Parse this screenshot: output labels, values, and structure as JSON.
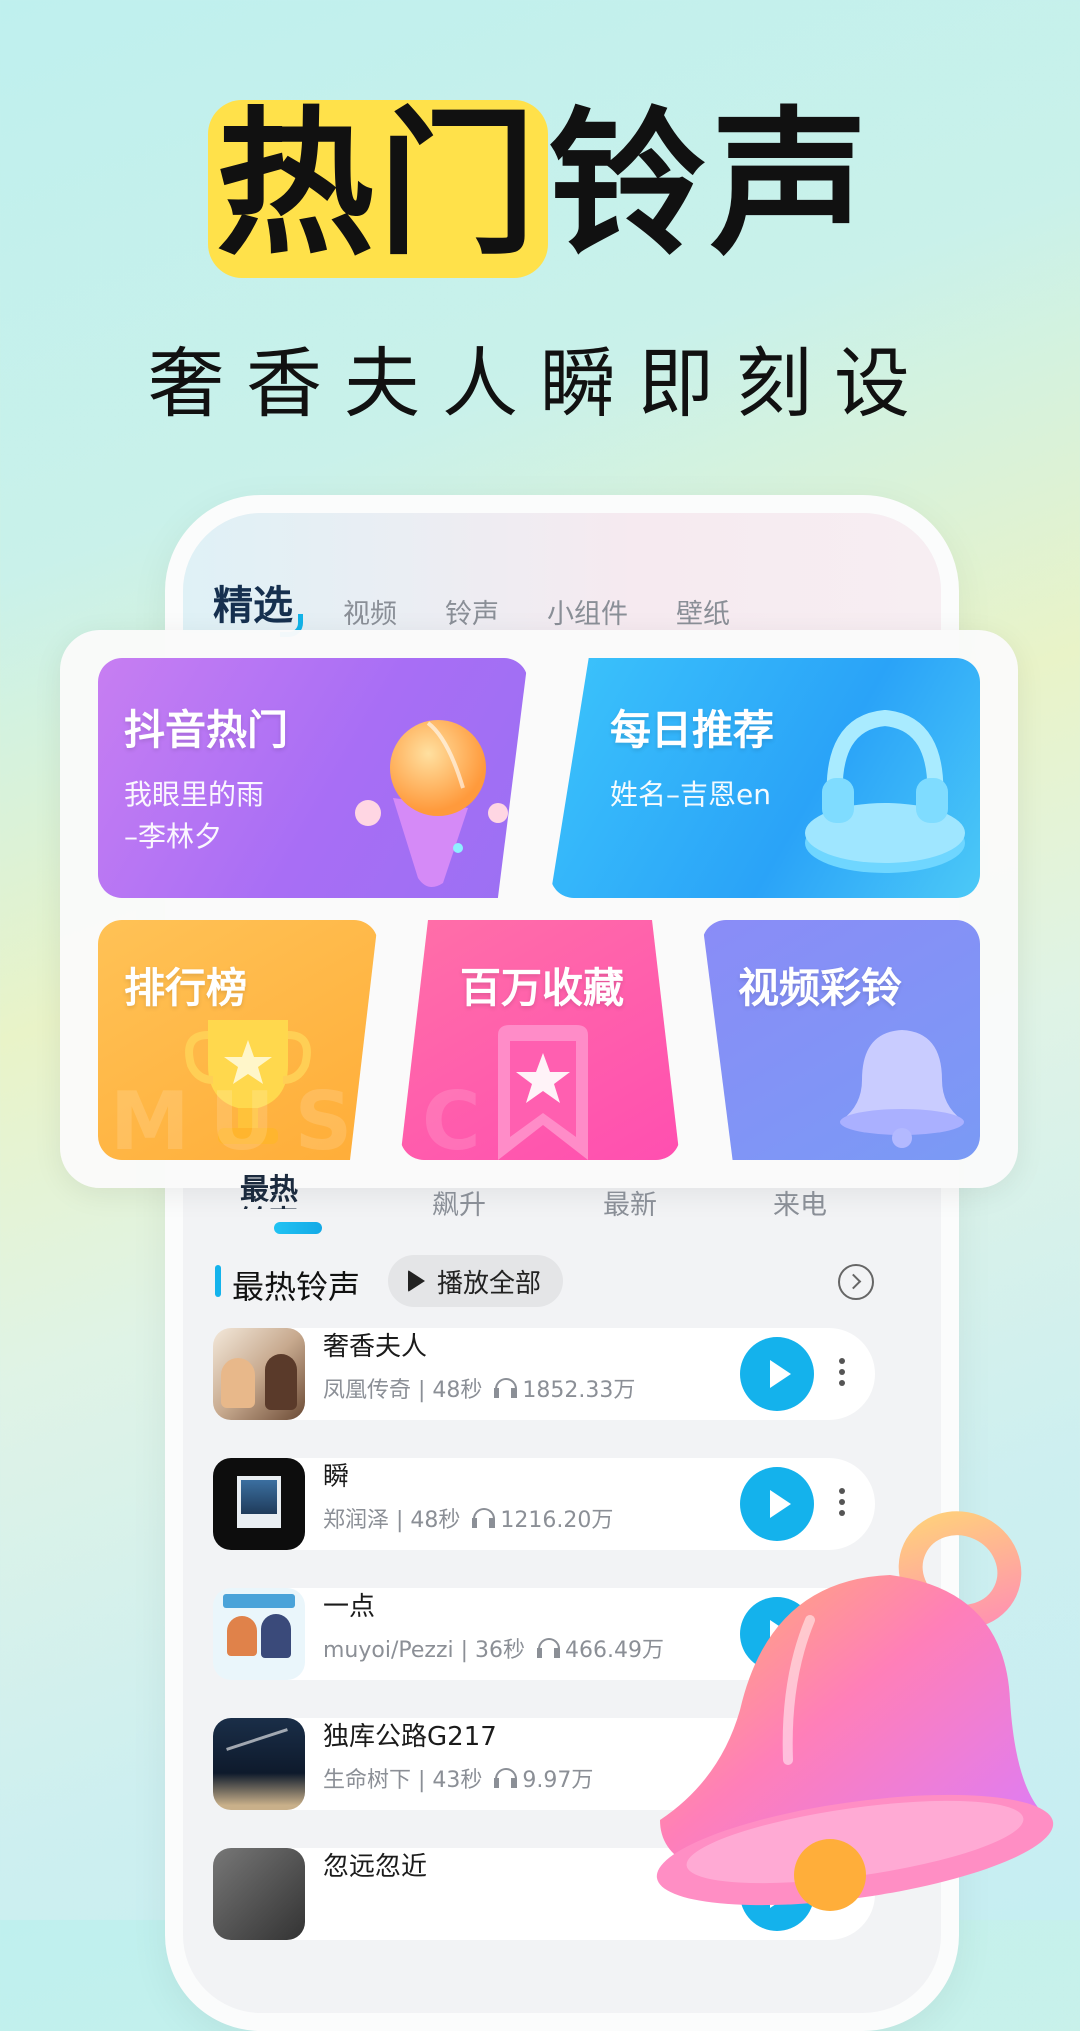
{
  "hero": {
    "title_highlight": "热门",
    "title_rest": "铃声",
    "subtitle": "奢香夫人瞬即刻设"
  },
  "tabs": [
    "精选",
    "视频",
    "铃声",
    "小组件",
    "壁纸"
  ],
  "features": {
    "douyin": {
      "title": "抖音热门",
      "sub1": "我眼里的雨",
      "sub2": "–李林夕"
    },
    "daily": {
      "title": "每日推荐",
      "sub": "姓名–吉恩en"
    },
    "rank": {
      "title": "排行榜"
    },
    "collect": {
      "title": "百万收藏"
    },
    "video": {
      "title": "视频彩铃"
    },
    "watermark": "MUSIC"
  },
  "rank_tabs": [
    "最热铃声",
    "飙升",
    "最新",
    "来电"
  ],
  "section": {
    "title": "最热铃声",
    "play_all": "播放全部"
  },
  "songs": [
    {
      "name": "奢香夫人",
      "meta": "凤凰传奇 | 48秒",
      "plays": "1852.33万"
    },
    {
      "name": "瞬",
      "meta": "郑润泽 | 48秒",
      "plays": "1216.20万"
    },
    {
      "name": "一点",
      "meta": "muyoi/Pezzi | 36秒",
      "plays": "466.49万"
    },
    {
      "name": "独库公路G217",
      "meta": "生命树下 | 43秒",
      "plays": "9.97万"
    },
    {
      "name": "忽远忽近",
      "meta": "",
      "plays": ""
    }
  ],
  "colors": {
    "accent": "#14b2ec",
    "highlight": "#ffe14a"
  }
}
